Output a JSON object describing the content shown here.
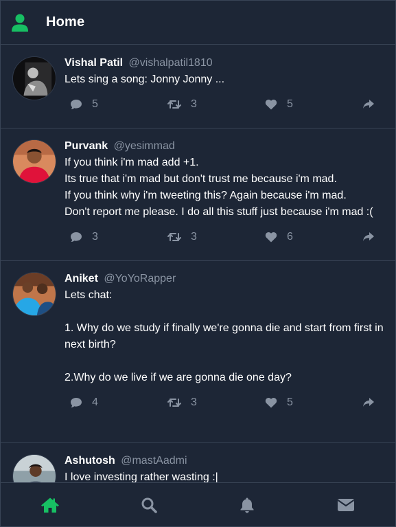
{
  "header": {
    "title": "Home",
    "icon": "user-icon",
    "accent_color": "#17bf63"
  },
  "tweets": [
    {
      "name": "Vishal Patil",
      "handle": "@vishalpatil1810",
      "body": "Lets sing a song: Jonny Jonny ...",
      "replies": "5",
      "retweets": "3",
      "likes": "5"
    },
    {
      "name": "Purvank",
      "handle": "@yesimmad",
      "body": "If you think i'm mad add +1.\nIts true that i'm mad but don't trust me because i'm mad.\nIf you think why i'm tweeting this? Again because i'm mad.\nDon't report me please. I do all this stuff just because i'm mad :(",
      "replies": "3",
      "retweets": "3",
      "likes": "6"
    },
    {
      "name": "Aniket",
      "handle": "@YoYoRapper",
      "body": "Lets chat:\n\n1. Why do we study if finally we're gonna die and start from first in next birth?\n\n2.Why do we live if we are gonna die one day?\n",
      "replies": "4",
      "retweets": "3",
      "likes": "5"
    },
    {
      "name": "Ashutosh",
      "handle": "@mastAadmi",
      "body": "I love investing rather wasting :|",
      "replies": "",
      "retweets": "",
      "likes": ""
    }
  ],
  "nav": {
    "items": [
      "home-icon",
      "search-icon",
      "bell-icon",
      "mail-icon"
    ],
    "active": "home-icon"
  }
}
